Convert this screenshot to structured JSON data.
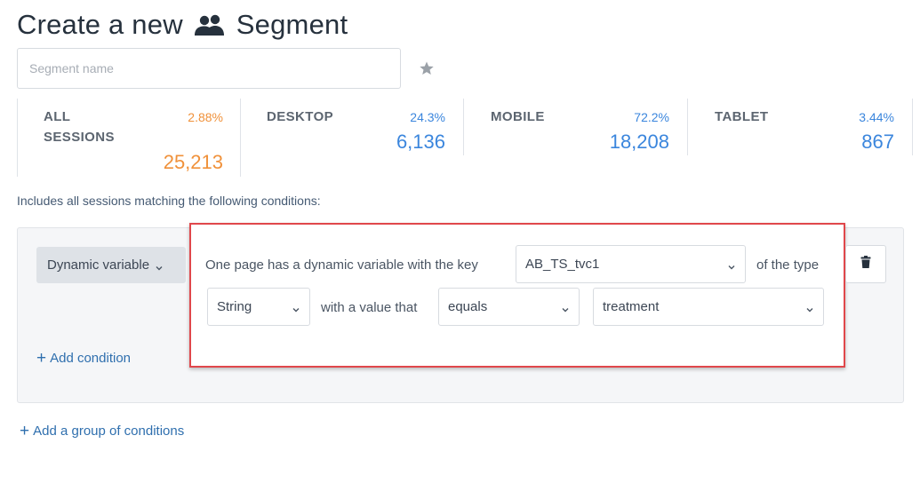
{
  "header": {
    "title_prefix": "Create a new",
    "title_icon": "people-icon",
    "title_suffix": "Segment"
  },
  "segment_name": {
    "placeholder": "Segment name",
    "value": "",
    "favorite_icon": "star-icon"
  },
  "stats": [
    {
      "label_line1": "ALL",
      "label_line2": "SESSIONS",
      "percent": "2.88%",
      "count": "25,213",
      "color": "#f0913a"
    },
    {
      "label_line1": "DESKTOP",
      "label_line2": "",
      "percent": "24.3%",
      "count": "6,136",
      "color": "#3b86dd"
    },
    {
      "label_line1": "MOBILE",
      "label_line2": "",
      "percent": "72.2%",
      "count": "18,208",
      "color": "#3b86dd"
    },
    {
      "label_line1": "TABLET",
      "label_line2": "",
      "percent": "3.44%",
      "count": "867",
      "color": "#3b86dd"
    }
  ],
  "conditions": {
    "caption": "Includes all sessions matching the following conditions:",
    "type_button": "Dynamic variable",
    "sentence_start": "One page has a dynamic variable with the key",
    "key_value": "AB_TS_tvc1",
    "sentence_type": "of the type",
    "type_value": "String",
    "sentence_value": "with a value that",
    "operator_value": "equals",
    "match_value": "treatment",
    "delete_icon": "trash-icon",
    "add_condition": "Add condition",
    "add_group": "Add a group of conditions"
  },
  "colors": {
    "highlight_border": "#e0474b",
    "link": "#2f6fae",
    "orange": "#f0913a",
    "blue": "#3b86dd"
  }
}
